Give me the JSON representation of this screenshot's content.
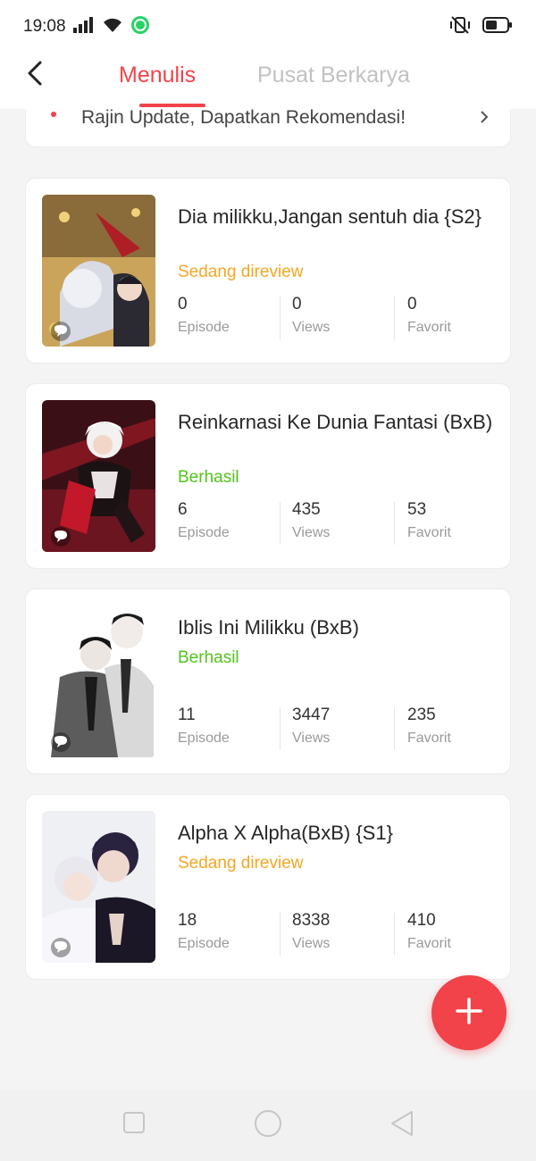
{
  "status_bar": {
    "time": "19:08"
  },
  "header": {
    "tabs": [
      {
        "label": "Menulis",
        "active": true
      },
      {
        "label": "Pusat Berkarya",
        "active": false
      }
    ]
  },
  "banner": {
    "text": "Rajin Update, Dapatkan Rekomendasi!"
  },
  "colors": {
    "accent": "#f2434a",
    "status_review": "#f5a623",
    "status_success": "#52c41a"
  },
  "works": [
    {
      "title": "Dia milikku,Jangan sentuh dia {S2}",
      "status": "Sedang direview",
      "status_type": "review",
      "stats": [
        {
          "value": "0",
          "label": "Episode"
        },
        {
          "value": "0",
          "label": "Views"
        },
        {
          "value": "0",
          "label": "Favorit"
        }
      ]
    },
    {
      "title": "Reinkarnasi Ke Dunia Fantasi (BxB)",
      "status": "Berhasil",
      "status_type": "success",
      "stats": [
        {
          "value": "6",
          "label": "Episode"
        },
        {
          "value": "435",
          "label": "Views"
        },
        {
          "value": "53",
          "label": "Favorit"
        }
      ]
    },
    {
      "title": "Iblis Ini Milikku (BxB)",
      "status": "Berhasil",
      "status_type": "success",
      "stats": [
        {
          "value": "11",
          "label": "Episode"
        },
        {
          "value": "3447",
          "label": "Views"
        },
        {
          "value": "235",
          "label": "Favorit"
        }
      ]
    },
    {
      "title": "Alpha X Alpha(BxB) {S1}",
      "status": "Sedang direview",
      "status_type": "review",
      "stats": [
        {
          "value": "18",
          "label": "Episode"
        },
        {
          "value": "8338",
          "label": "Views"
        },
        {
          "value": "410",
          "label": "Favorit"
        }
      ]
    }
  ],
  "icons": {
    "back": "chevron-left-icon",
    "add": "plus-icon",
    "comment": "chat-bubble-icon",
    "nav_recent": "square-icon",
    "nav_home": "circle-icon",
    "nav_back": "triangle-back-icon"
  }
}
